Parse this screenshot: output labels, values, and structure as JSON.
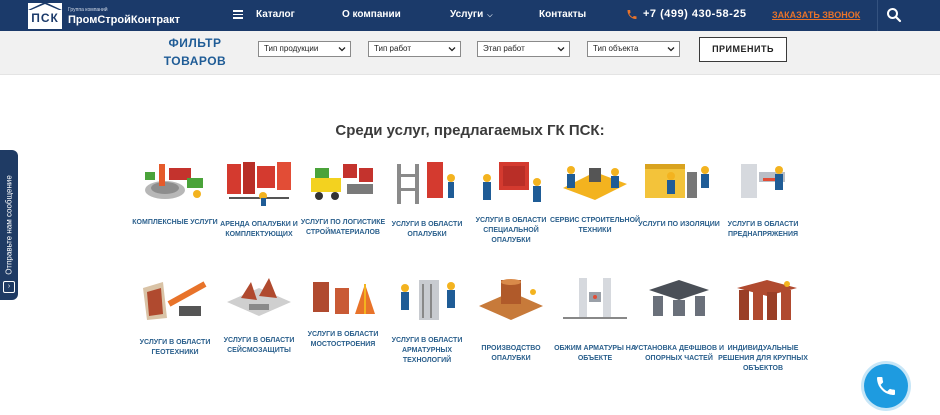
{
  "header": {
    "logo_box_text": "ПСК",
    "logo_small": "Группа компаний",
    "logo_name": "ПромСтройКонтракт",
    "nav": {
      "catalog": "Каталог",
      "about": "О компании",
      "services": "Услуги",
      "contacts": "Контакты"
    },
    "phone": "+7 (499) 430-58-25",
    "callback": "ЗАКАЗАТЬ ЗВОНОК",
    "colors": {
      "background": "#1b3a6a",
      "accent": "#e8732a"
    },
    "icons": [
      "menu-icon",
      "chevron-down-icon",
      "phone-icon",
      "search-icon"
    ]
  },
  "filter": {
    "title": "ФИЛЬТР ТОВАРОВ",
    "selects": [
      {
        "value": "Тип продукции"
      },
      {
        "value": "Тип работ"
      },
      {
        "value": "Этап работ"
      },
      {
        "value": "Тип объекта"
      }
    ],
    "apply": "ПРИМЕНИТЬ"
  },
  "services": {
    "title": "Среди услуг, предлагаемых ГК ПСК:",
    "items": [
      {
        "label": "Комплексные услуги",
        "icon": "complex-services-icon"
      },
      {
        "label": "Аренда опалубки и комплектующих",
        "icon": "formwork-rent-icon"
      },
      {
        "label": "Услуги по логистике стройматериалов",
        "icon": "logistics-icon"
      },
      {
        "label": "Услуги в области опалубки",
        "icon": "formwork-icon"
      },
      {
        "label": "Услуги в области специальной опалубки",
        "icon": "special-formwork-icon"
      },
      {
        "label": "Сервис строительной техники",
        "icon": "machinery-service-icon"
      },
      {
        "label": "Услуги по изоляции",
        "icon": "insulation-icon"
      },
      {
        "label": "Услуги в области преднапряжения",
        "icon": "prestressing-icon"
      },
      {
        "label": "Услуги в области геотехники",
        "icon": "geotechnics-icon"
      },
      {
        "label": "Услуги в области сейсмозащиты",
        "icon": "seismic-protection-icon"
      },
      {
        "label": "Услуги в области мостостроения",
        "icon": "bridge-building-icon"
      },
      {
        "label": "Услуги в области арматурных технологий",
        "icon": "rebar-technology-icon"
      },
      {
        "label": "Производство опалубки",
        "icon": "formwork-production-icon"
      },
      {
        "label": "Обжим арматуры на объекте",
        "icon": "rebar-crimping-icon"
      },
      {
        "label": "Установка дефшвов и опорных частей",
        "icon": "bearings-installation-icon"
      },
      {
        "label": "Индивидуальные решения для крупных объектов",
        "icon": "custom-solutions-icon"
      }
    ]
  },
  "side_tab": {
    "label": "Отправьте нам сообщение",
    "icon": "chevron-right-icon"
  },
  "call_button": {
    "icon": "phone-icon",
    "color": "#1e9be0"
  }
}
